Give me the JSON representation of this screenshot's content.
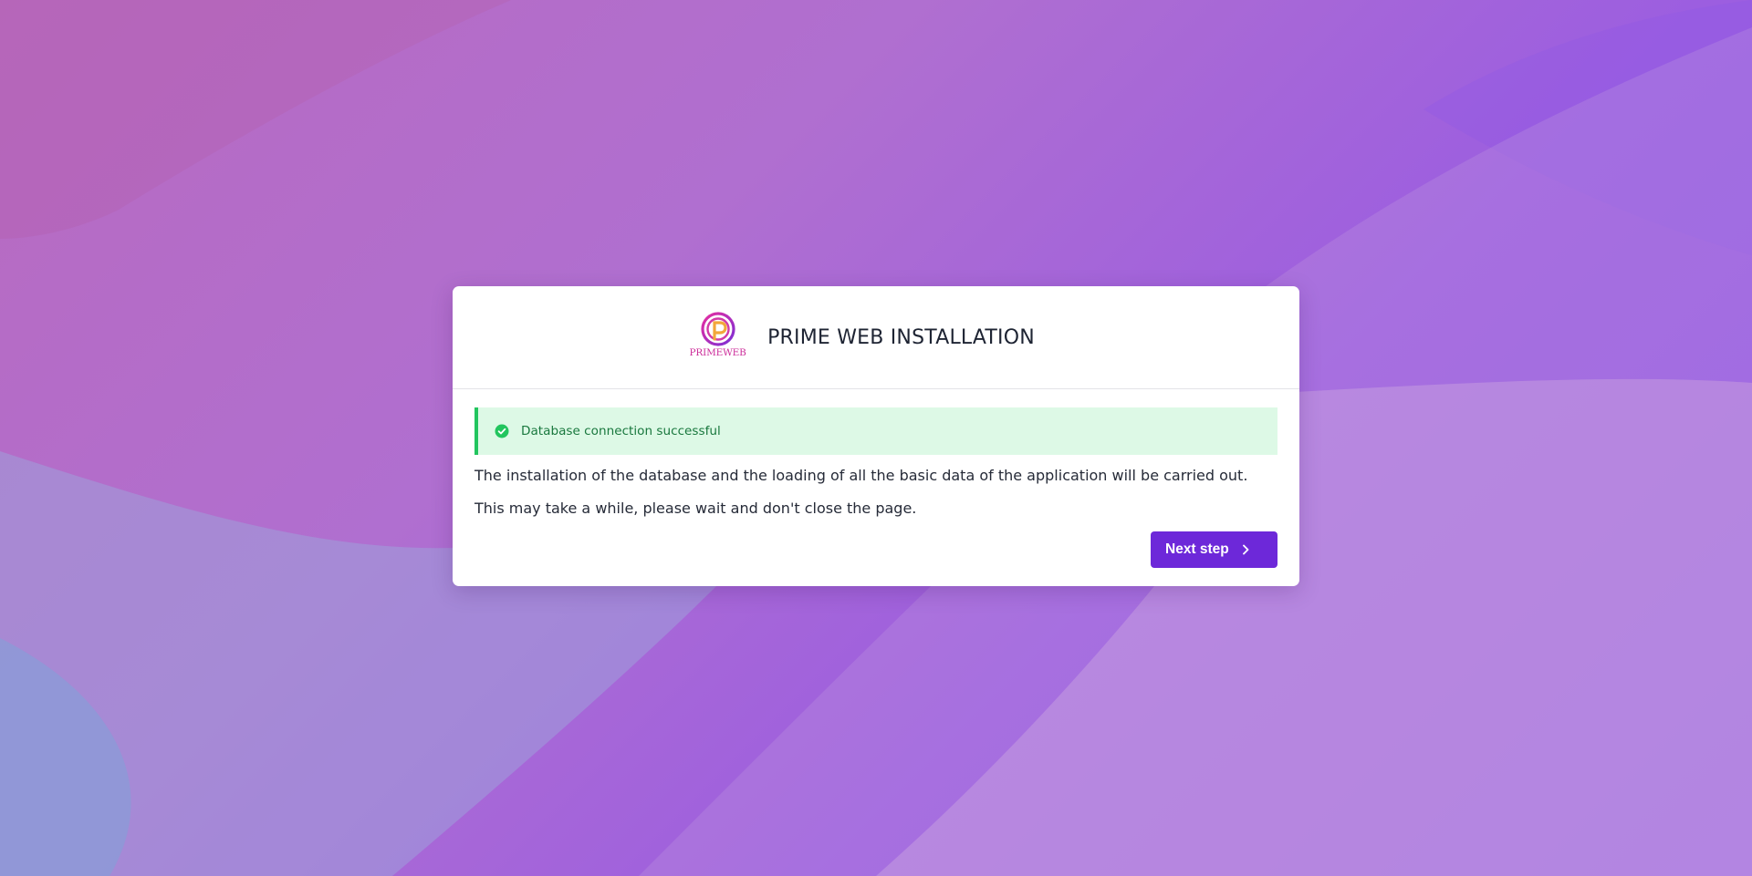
{
  "header": {
    "title": "PRIME WEB INSTALLATION",
    "logo_text": "PRIMEWEB"
  },
  "alert": {
    "message": "Database connection successful",
    "icon": "check-circle-icon",
    "status_color": "#22c55e"
  },
  "body": {
    "paragraph_1": "The installation of the database and the loading of all the basic data of the application will be carried out.",
    "paragraph_2": "This may take a while, please wait and don't close the page."
  },
  "actions": {
    "next_label": "Next step",
    "next_icon": "chevron-right-icon",
    "accent_color": "#6d28d9"
  }
}
